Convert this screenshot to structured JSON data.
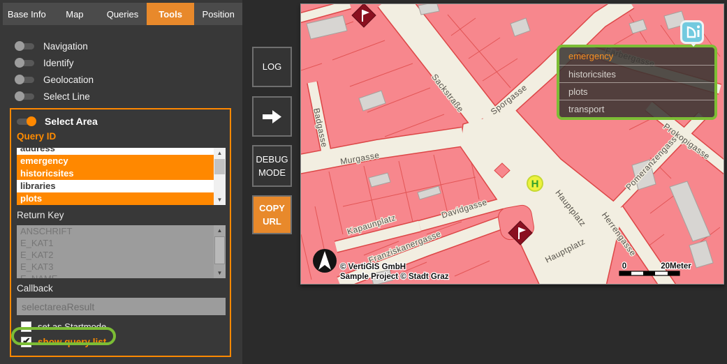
{
  "tabs": {
    "items": [
      "Base Info",
      "Map",
      "Queries",
      "Tools",
      "Position"
    ],
    "active": "Tools"
  },
  "toggles": {
    "items": [
      "Navigation",
      "Identify",
      "Geolocation",
      "Select Line"
    ]
  },
  "select_area": {
    "title": "Select Area",
    "query_id_label": "Query ID",
    "query_options": [
      {
        "label": "address",
        "selected": false
      },
      {
        "label": "emergency",
        "selected": true
      },
      {
        "label": "historicsites",
        "selected": true
      },
      {
        "label": "libraries",
        "selected": false
      },
      {
        "label": "plots",
        "selected": true
      }
    ],
    "return_key_label": "Return Key",
    "return_options": [
      "ANSCHRIFT",
      "E_KAT1",
      "E_KAT2",
      "E_KAT3",
      "E_NAME"
    ],
    "callback_label": "Callback",
    "callback_value": "selectareaResult",
    "startmode_checkbox": {
      "label": "set as Startmode",
      "checked": false
    },
    "querylist_checkbox": {
      "label": "show query list",
      "checked": true
    }
  },
  "actions": {
    "log": "LOG",
    "debug_mode": "DEBUG MODE",
    "copy_url": "COPY URL",
    "arrow_icon": "right-arrow"
  },
  "map": {
    "streets": [
      "Sackstraße",
      "Sporgasse",
      "Färbergasse",
      "Badgasse",
      "Murgasse",
      "Kapaunplatz",
      "Davidgasse",
      "Franziskanergasse",
      "Hauptplatz",
      "Hauptplatz",
      "Herrengasse",
      "Pomeranzengasse",
      "Prokopigasse"
    ],
    "overlay": {
      "items": [
        "emergency",
        "historicsites",
        "plots",
        "transport"
      ],
      "active": "emergency"
    },
    "h_stop_label": "H",
    "attribution_line1": "© VertiGIS GmbH",
    "attribution_line2": "Sample Project © Stadt Graz",
    "scale": {
      "start": "0",
      "end": "20Meter"
    }
  },
  "colors": {
    "accent_orange": "#ff8800",
    "tab_orange": "#e8892b",
    "highlight_green": "#7cbd35",
    "building_pink": "#f7878d",
    "building_stroke": "#dc4646",
    "street_cream": "#f2eee1",
    "marker_dark_red": "#8a1020",
    "bus_stop_yellow": "#edf23d"
  }
}
